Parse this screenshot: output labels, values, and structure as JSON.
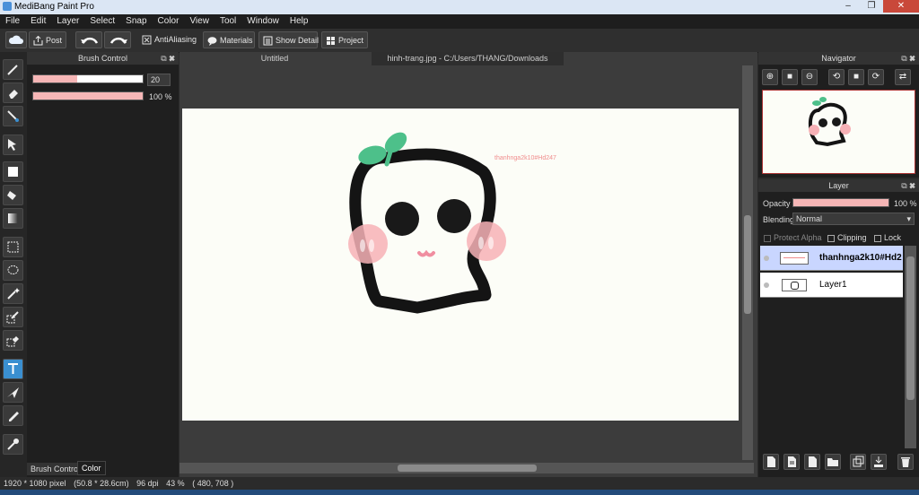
{
  "window": {
    "title": "MediBang Paint Pro"
  },
  "menu": [
    "File",
    "Edit",
    "Layer",
    "Select",
    "Snap",
    "Color",
    "View",
    "Tool",
    "Window",
    "Help"
  ],
  "toolbar": {
    "post": "Post",
    "antialiasing": "AntiAliasing",
    "materials": "Materials",
    "show_detail": "Show Detail",
    "project": "Project"
  },
  "brush_control": {
    "title": "Brush Control",
    "size_value": "20",
    "opacity_value": "100 %",
    "tabs": [
      "Brush Control",
      "Color"
    ]
  },
  "documents": {
    "tabs": [
      "Untitled",
      "hinh-trang.jpg - C:/Users/THANG/Downloads"
    ]
  },
  "canvas": {
    "watermark_text": "thanhnga2k10#Hd247"
  },
  "navigator": {
    "title": "Navigator"
  },
  "layer_panel": {
    "title": "Layer",
    "opacity_label": "Opacity",
    "opacity_value": "100 %",
    "blending_label": "Blending",
    "blending_value": "Normal",
    "protect_alpha": "Protect Alpha",
    "clipping": "Clipping",
    "lock": "Lock",
    "layers": [
      {
        "name": "thanhnga2k10#Hd2",
        "selected": true
      },
      {
        "name": "Layer1",
        "selected": false
      }
    ]
  },
  "status": {
    "size_px": "1920 * 1080 pixel",
    "size_cm": "(50.8 * 28.6cm)",
    "dpi": "96 dpi",
    "zoom": "43 %",
    "cursor": "( 480, 708 )"
  },
  "colors": {
    "accent": "#3a8fd0",
    "pink": "#f6b6b6",
    "leaf": "#4dc08a"
  }
}
